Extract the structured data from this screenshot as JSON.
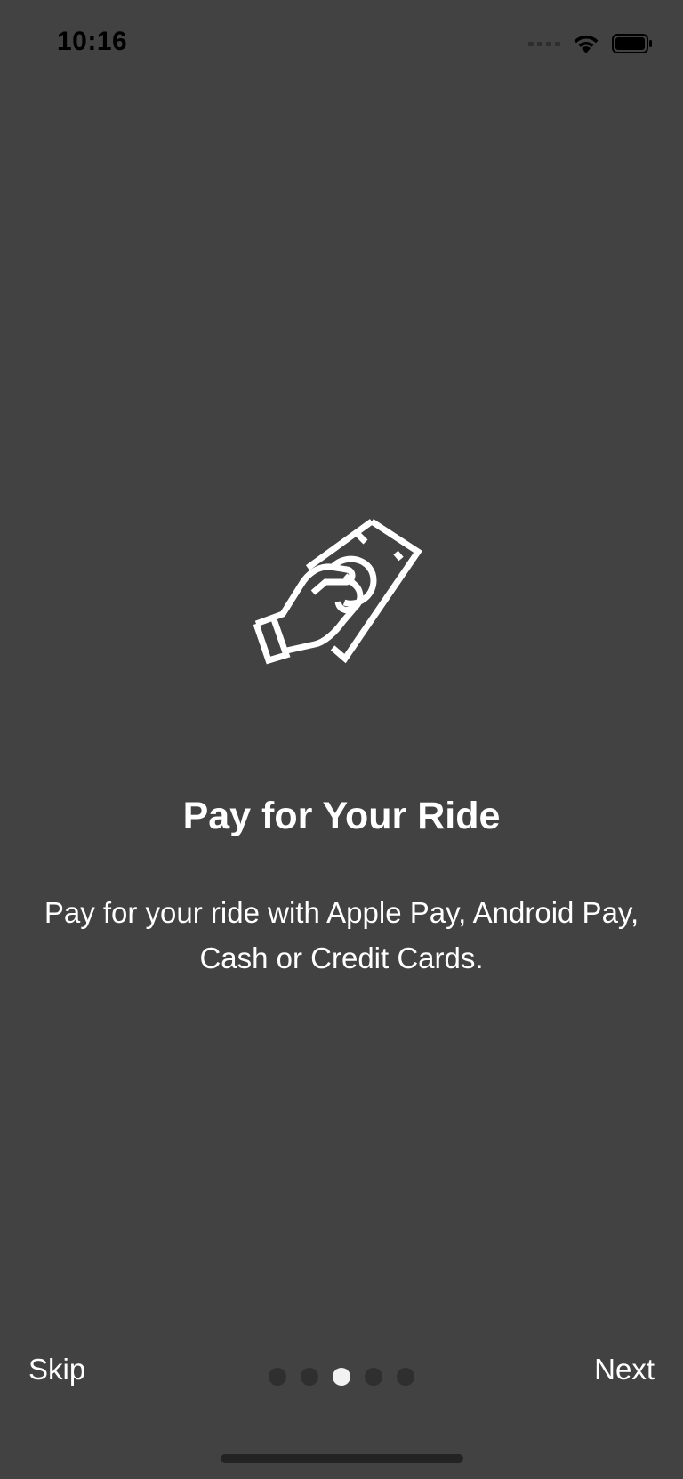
{
  "status_bar": {
    "time": "10:16",
    "icons": [
      "signal-icon",
      "wifi-icon",
      "battery-icon"
    ]
  },
  "onboarding": {
    "icon": "hand-cash-icon",
    "title": "Pay for Your Ride",
    "description": "Pay for your ride with Apple Pay, Android Pay, Cash or Credit Cards."
  },
  "navigation": {
    "skip_label": "Skip",
    "next_label": "Next",
    "page_count": 5,
    "current_page": 3
  },
  "colors": {
    "background": "#424242",
    "text": "#ffffff",
    "dot_active": "#f2f2f2",
    "dot_inactive": "#2f2f2f"
  }
}
